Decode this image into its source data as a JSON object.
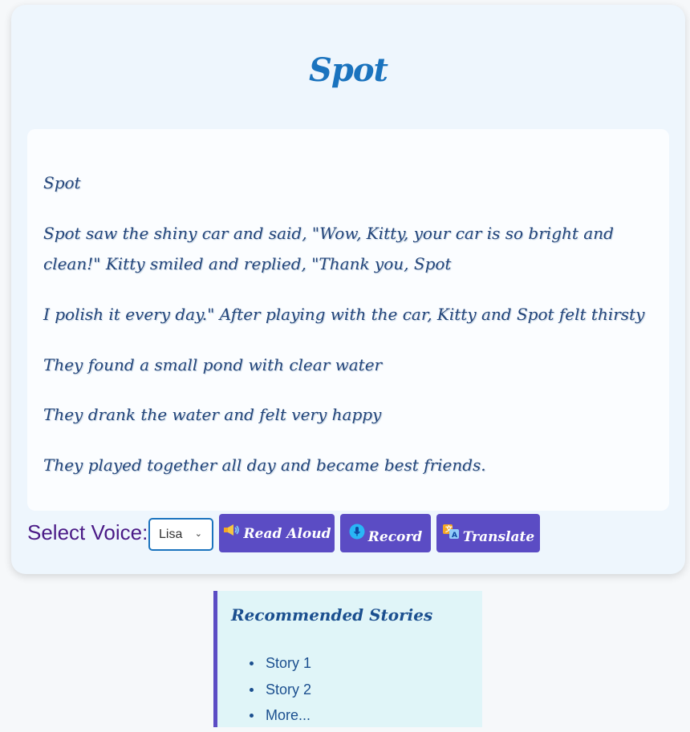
{
  "story": {
    "title": "Spot",
    "paragraphs": [
      "Spot",
      "Spot saw the shiny car and said, \"Wow, Kitty, your car is so bright and clean!\" Kitty smiled and replied, \"Thank you, Spot",
      "I polish it every day.\" After playing with the car, Kitty and Spot felt thirsty",
      "They found a small pond with clear water",
      "They drank the water and felt very happy",
      "They played together all day and became best friends."
    ]
  },
  "controls": {
    "voice_label": "Select Voice:",
    "voice_selected": "Lisa",
    "read_aloud_label": "Read Aloud",
    "record_label": "Record",
    "translate_label": "Translate"
  },
  "icons": {
    "read_aloud": "megaphone-icon",
    "record": "microphone-icon",
    "translate": "translate-icon"
  },
  "recommended": {
    "title": "Recommended Stories",
    "items": [
      "Story 1",
      "Story 2",
      "More..."
    ]
  },
  "colors": {
    "accent": "#5b4cc4",
    "title": "#1a73be",
    "text": "#23457a"
  }
}
